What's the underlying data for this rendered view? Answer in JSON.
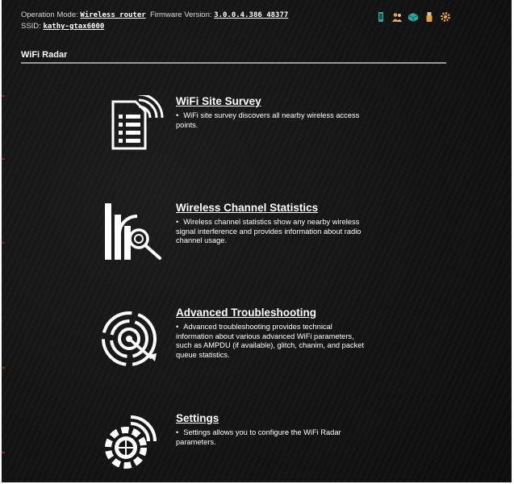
{
  "header": {
    "operation_mode_label": "Operation Mode:",
    "operation_mode_value": "Wireless router",
    "firmware_label": "Firmware Version:",
    "firmware_value": "3.0.0.4.386_48377",
    "ssid_label": "SSID:",
    "ssid_value": "kathy-gtax6000",
    "icons": [
      "mobile-device-icon",
      "users-icon",
      "network-icon",
      "usb-icon",
      "settings-gear-icon"
    ]
  },
  "page": {
    "title": "WiFi Radar"
  },
  "features": [
    {
      "title": "WiFi Site Survey",
      "bullet": "•",
      "description": "WiFi site survey discovers all nearby wireless access points.",
      "icon": "site-survey-icon"
    },
    {
      "title": "Wireless Channel Statistics",
      "bullet": "•",
      "description": "Wireless channel statistics show any nearby wireless signal interference and provides information about radio channel usage.",
      "icon": "channel-statistics-icon"
    },
    {
      "title": "Advanced Troubleshooting",
      "bullet": "•",
      "description": "Advanced troubleshooting provides technical information about various advanced WiFi parameters, such as AMPDU (if available), glitch, chanim, and packet queue statistics.",
      "icon": "troubleshooting-target-icon"
    },
    {
      "title": "Settings",
      "bullet": "•",
      "description": "Settings allows you to configure the WiFi Radar parameters.",
      "icon": "settings-icon"
    }
  ],
  "colors": {
    "background": "#141414",
    "text": "#ffffff",
    "accent": "#e8a23a",
    "teal": "#2aa8a0"
  }
}
